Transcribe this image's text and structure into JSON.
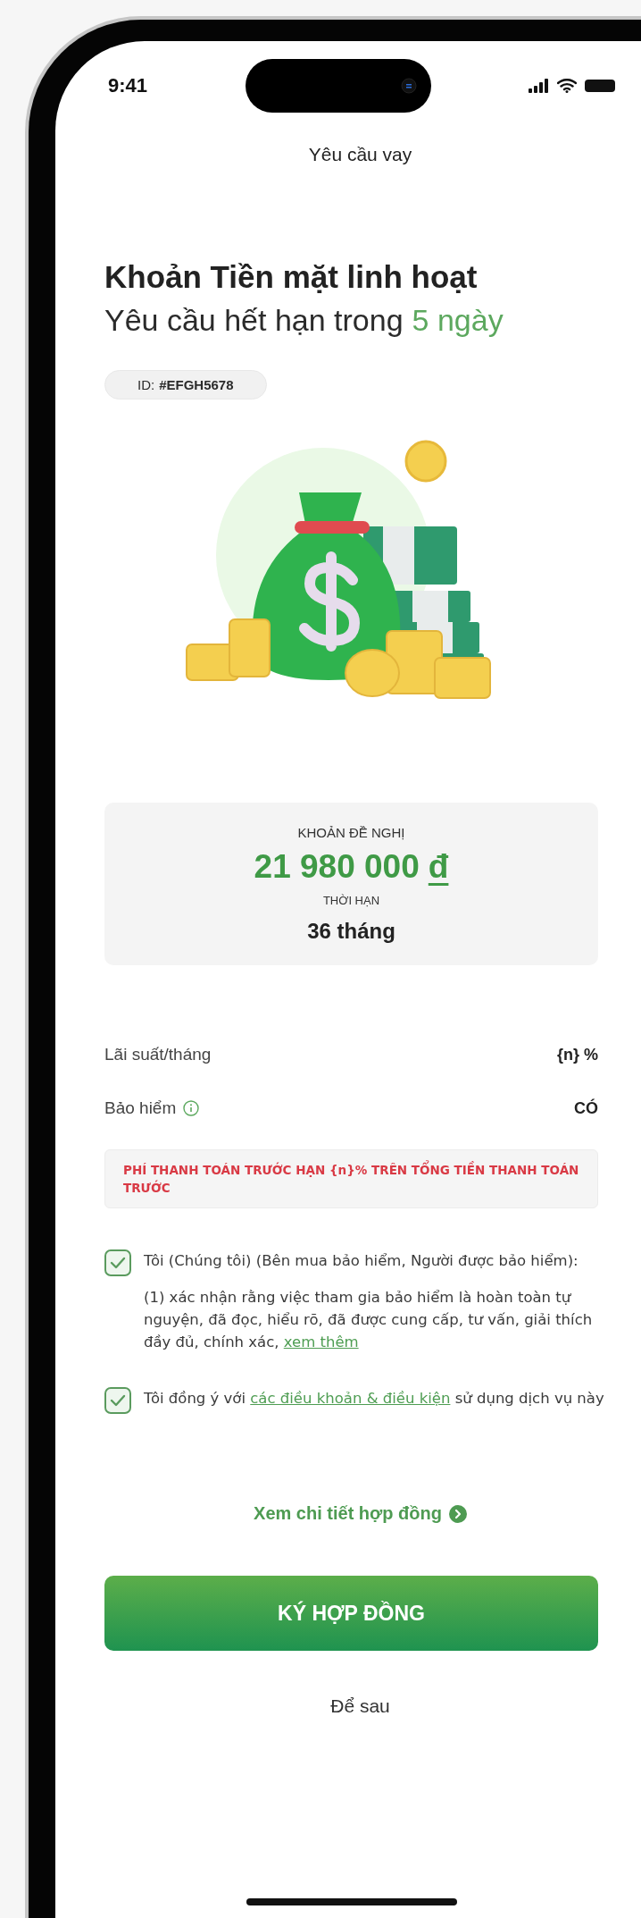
{
  "status_bar": {
    "time": "9:41"
  },
  "header": {
    "title": "Yêu cầu vay"
  },
  "loan": {
    "product": "Khoản Tiền mặt linh hoạt",
    "expiry_text": "Yêu cầu hết hạn trong",
    "expiry_days": "5 ngày",
    "id_label": "ID:",
    "id_value": "#EFGH5678"
  },
  "offer": {
    "amount_label": "KHOẢN ĐỀ NGHỊ",
    "amount": "21 980 000",
    "currency": "đ",
    "term_label": "THỜI HẠN",
    "term": "36 tháng"
  },
  "details": [
    {
      "label": "Lãi suất/tháng",
      "value": "{n} %",
      "info": false
    },
    {
      "label": "Bảo hiểm",
      "value": "CÓ",
      "info": true
    }
  ],
  "warning": "PHÍ THANH TOÁN TRƯỚC HẠN {n}% TRÊN TỔNG TIỀN THANH TOÁN TRƯỚC",
  "consents": [
    {
      "checked": true,
      "text": "Tôi (Chúng tôi) (Bên mua bảo hiểm, Người được bảo hiểm):",
      "note": {
        "text": "(1) xác nhận rằng việc tham gia bảo hiểm là hoàn toàn tự nguyện, đã đọc, hiểu rõ, đã được cung cấp, tư vấn, giải thích đầy đủ, chính xác,",
        "link": "xem thêm"
      }
    },
    {
      "checked": true,
      "text": "Tôi đồng ý với",
      "link": "các điều khoản & điều kiện",
      "text_after": "sử dụng dịch vụ này"
    }
  ],
  "contract_link": "Xem chi tiết hợp đồng",
  "primary_button": "KÝ HỢP ĐỒNG",
  "secondary_button": "Để sau"
}
